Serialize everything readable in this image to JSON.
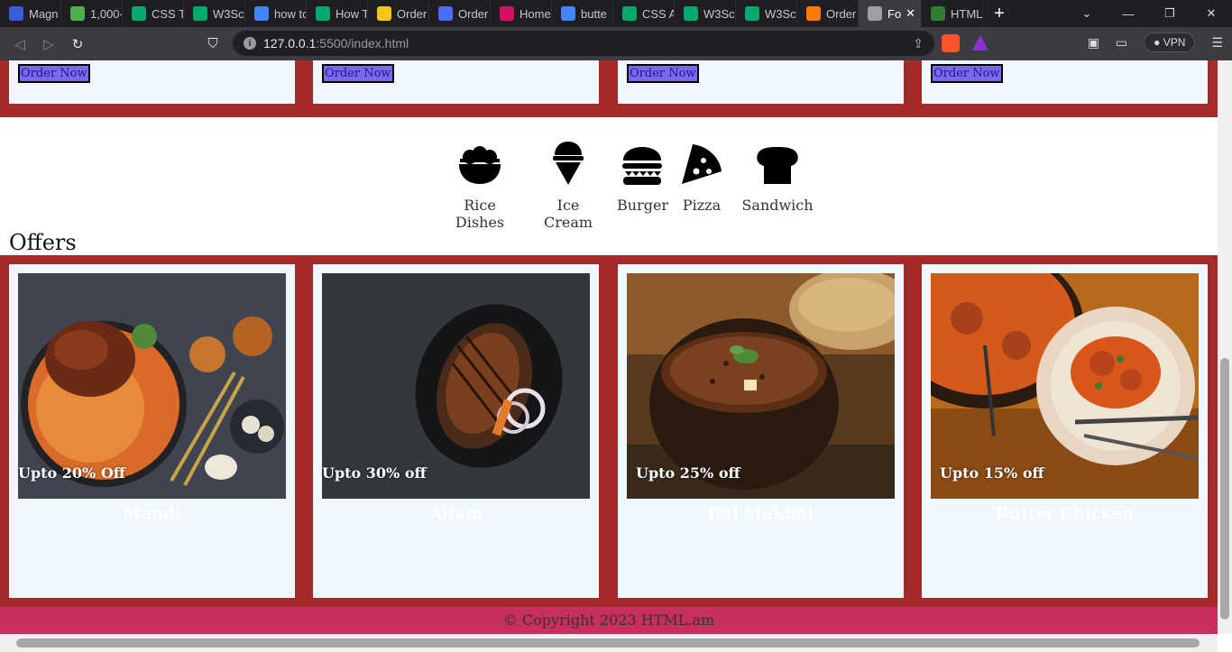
{
  "browser": {
    "tabs": [
      {
        "label": "Magn",
        "icon": "flag-icon",
        "color": "#3b5bdb"
      },
      {
        "label": "1,000-",
        "icon": "px-icon",
        "color": "#4caf50"
      },
      {
        "label": "CSS Te",
        "icon": "w3schools-icon",
        "color": "#04aa6d"
      },
      {
        "label": "W3Sc",
        "icon": "w3schools-icon",
        "color": "#04aa6d"
      },
      {
        "label": "how to",
        "icon": "google-icon",
        "color": "#4285f4"
      },
      {
        "label": "How T",
        "icon": "w3schools-icon",
        "color": "#04aa6d"
      },
      {
        "label": "Order",
        "icon": "food-icon",
        "color": "#f5c518"
      },
      {
        "label": "Order",
        "icon": "grid-icon",
        "color": "#4c6ef5"
      },
      {
        "label": "Home",
        "icon": "panda-icon",
        "color": "#d70f64"
      },
      {
        "label": "butte",
        "icon": "google-icon",
        "color": "#4285f4"
      },
      {
        "label": "CSS A",
        "icon": "w3schools-icon",
        "color": "#04aa6d"
      },
      {
        "label": "W3Sc",
        "icon": "w3schools-icon",
        "color": "#04aa6d"
      },
      {
        "label": "W3Sc",
        "icon": "w3schools-icon",
        "color": "#04aa6d"
      },
      {
        "label": "Order",
        "icon": "pin-icon",
        "color": "#ff7a00"
      },
      {
        "label": "Fo",
        "icon": "globe-icon",
        "color": "#9aa0a6",
        "active": true
      },
      {
        "label": "HTML",
        "icon": "h-icon",
        "color": "#2e7d32"
      }
    ],
    "url_host": "127.0.0.1",
    "url_rest": ":5500/index.html",
    "vpn_label": "VPN"
  },
  "order_button_label": "Order Now",
  "categories": [
    {
      "label": "Rice Dishes",
      "icon": "rice-bowl-icon"
    },
    {
      "label": "Ice Cream",
      "icon": "ice-cream-icon"
    },
    {
      "label": "Burger",
      "icon": "burger-icon"
    },
    {
      "label": "Pizza",
      "icon": "pizza-slice-icon"
    },
    {
      "label": "Sandwich",
      "icon": "bread-icon"
    }
  ],
  "offers_title": "Offers",
  "offers": [
    {
      "name": "Mandi",
      "discount": "Upto 20% Off"
    },
    {
      "name": "Alfam",
      "discount": "Upto 30% off"
    },
    {
      "name": "Dal Makhni",
      "discount": "Upto 25% off"
    },
    {
      "name": "Butter Chicken",
      "discount": "Upto 15% off"
    }
  ],
  "footer_text": "© Copyright 2023 HTML.am",
  "colors": {
    "strip": "#a52a2a",
    "card": "#f0f8ff",
    "button": "#7b68ee",
    "footer": "#c62f5e"
  }
}
